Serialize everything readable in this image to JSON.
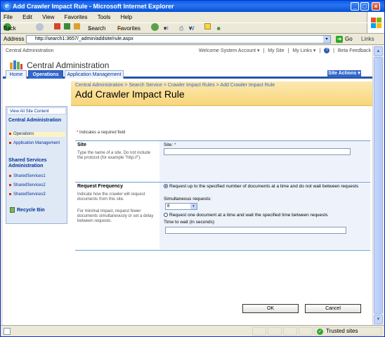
{
  "window": {
    "title": "Add Crawler Impact Rule - Microsoft Internet Explorer"
  },
  "menu": [
    "File",
    "Edit",
    "View",
    "Favorites",
    "Tools",
    "Help"
  ],
  "toolbar": {
    "back": "Back",
    "search": "Search",
    "favorites": "Favorites"
  },
  "address": {
    "label": "Address",
    "url": "http://search1:3657/_admin/addsite/rule.aspx",
    "go": "Go",
    "links": "Links"
  },
  "sharepoint": {
    "top_crumb": "Central Administration",
    "welcome": "Welcome System Account ▾",
    "my_site": "My Site",
    "my_links": "My Links ▾",
    "beta_feedback": "Beta Feedback",
    "site_title": "Central Administration",
    "tabs": [
      "Home",
      "Operations",
      "Application Management"
    ],
    "site_actions": "Site Actions ▾",
    "breadcrumb": "Central Administration > Search Service > Crawler Impact Rules > Add Crawler Impact Rule",
    "page_title": "Add Crawler Impact Rule"
  },
  "nav": {
    "view_all": "View All Site Content",
    "section1": "Central Administration",
    "section1_items": [
      "Operations",
      "Application Management"
    ],
    "section2": "Shared Services Administration",
    "section2_items": [
      "SharedServices1",
      "SharedServices2",
      "SharedServices3"
    ],
    "recycle_bin": "Recycle Bin"
  },
  "form": {
    "required_star": "*",
    "required_note": "Indicates a required field",
    "site_heading": "Site",
    "site_desc": "Type the name of a site. Do not include the protocol (for example \"http://\").",
    "site_label": "Site:",
    "site_value": "",
    "freq_heading": "Request Frequency",
    "freq_desc1": "Indicate how the crawler will request documents from this site.",
    "freq_desc2": "For minimal impact, request fewer documents simultaneously or set a delay between requests.",
    "option1": "Request up to the specified number of documents at a time and do not wait between requests",
    "simultaneous_label": "Simultaneous requests:",
    "simultaneous_value": "8",
    "option2": "Request one document at a time and wait the specified time between requests",
    "wait_label": "Time to wait (in seconds)",
    "wait_value": "",
    "ok": "OK",
    "cancel": "Cancel"
  },
  "status": {
    "zone": "Trusted sites"
  }
}
